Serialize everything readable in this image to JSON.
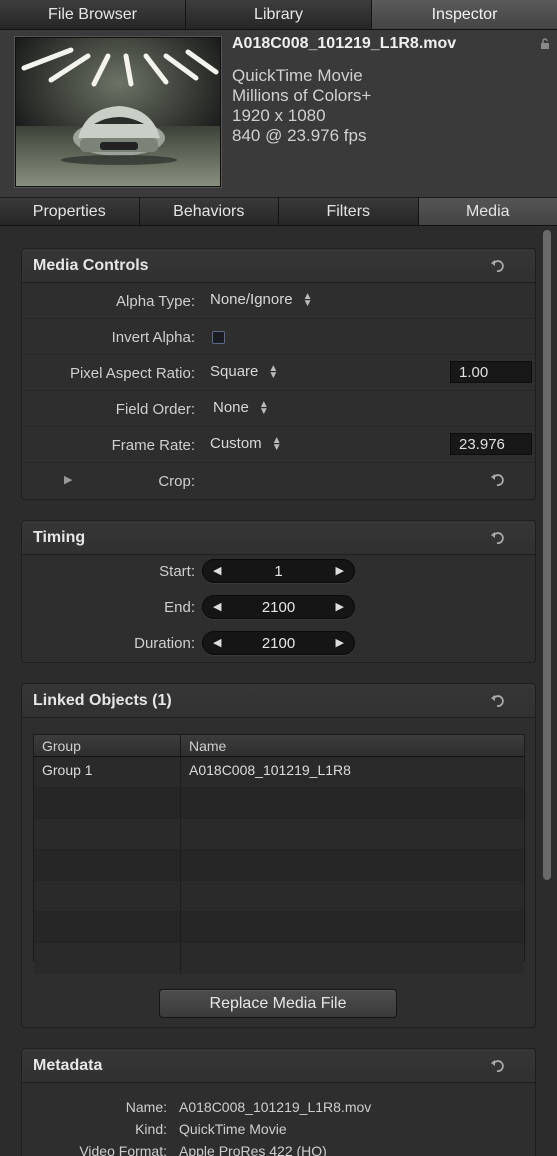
{
  "top_tabs": [
    "File Browser",
    "Library",
    "Inspector"
  ],
  "file": {
    "name": "A018C008_101219_L1R8.mov",
    "lines": [
      "QuickTime Movie",
      "Millions of Colors+",
      "1920 x 1080",
      "840 @ 23.976 fps"
    ]
  },
  "sub_tabs": [
    "Properties",
    "Behaviors",
    "Filters",
    "Media"
  ],
  "media_controls": {
    "title": "Media Controls",
    "alpha_type_label": "Alpha Type:",
    "alpha_type_value": "None/Ignore",
    "invert_alpha_label": "Invert Alpha:",
    "par_label": "Pixel Aspect Ratio:",
    "par_value": "Square",
    "par_field": "1.00",
    "field_order_label": "Field Order:",
    "field_order_value": "None",
    "frame_rate_label": "Frame Rate:",
    "frame_rate_value": "Custom",
    "frame_rate_field": "23.976",
    "crop_label": "Crop:"
  },
  "timing": {
    "title": "Timing",
    "start_label": "Start:",
    "start_value": "1",
    "end_label": "End:",
    "end_value": "2100",
    "duration_label": "Duration:",
    "duration_value": "2100"
  },
  "linked": {
    "title": "Linked Objects (1)",
    "col_group": "Group",
    "col_name": "Name",
    "rows": [
      {
        "group": "Group 1",
        "name": "A018C008_101219_L1R8"
      }
    ],
    "replace_label": "Replace Media File"
  },
  "metadata": {
    "title": "Metadata",
    "name_label": "Name:",
    "name_value": "A018C008_101219_L1R8.mov",
    "kind_label": "Kind:",
    "kind_value": "QuickTime Movie",
    "format_label": "Video Format:",
    "format_value": "Apple ProRes 422 (HQ)"
  },
  "icons": {
    "reset": "reset-arrow-icon",
    "lock": "lock-icon",
    "disclosure": "disclosure-triangle-icon"
  }
}
